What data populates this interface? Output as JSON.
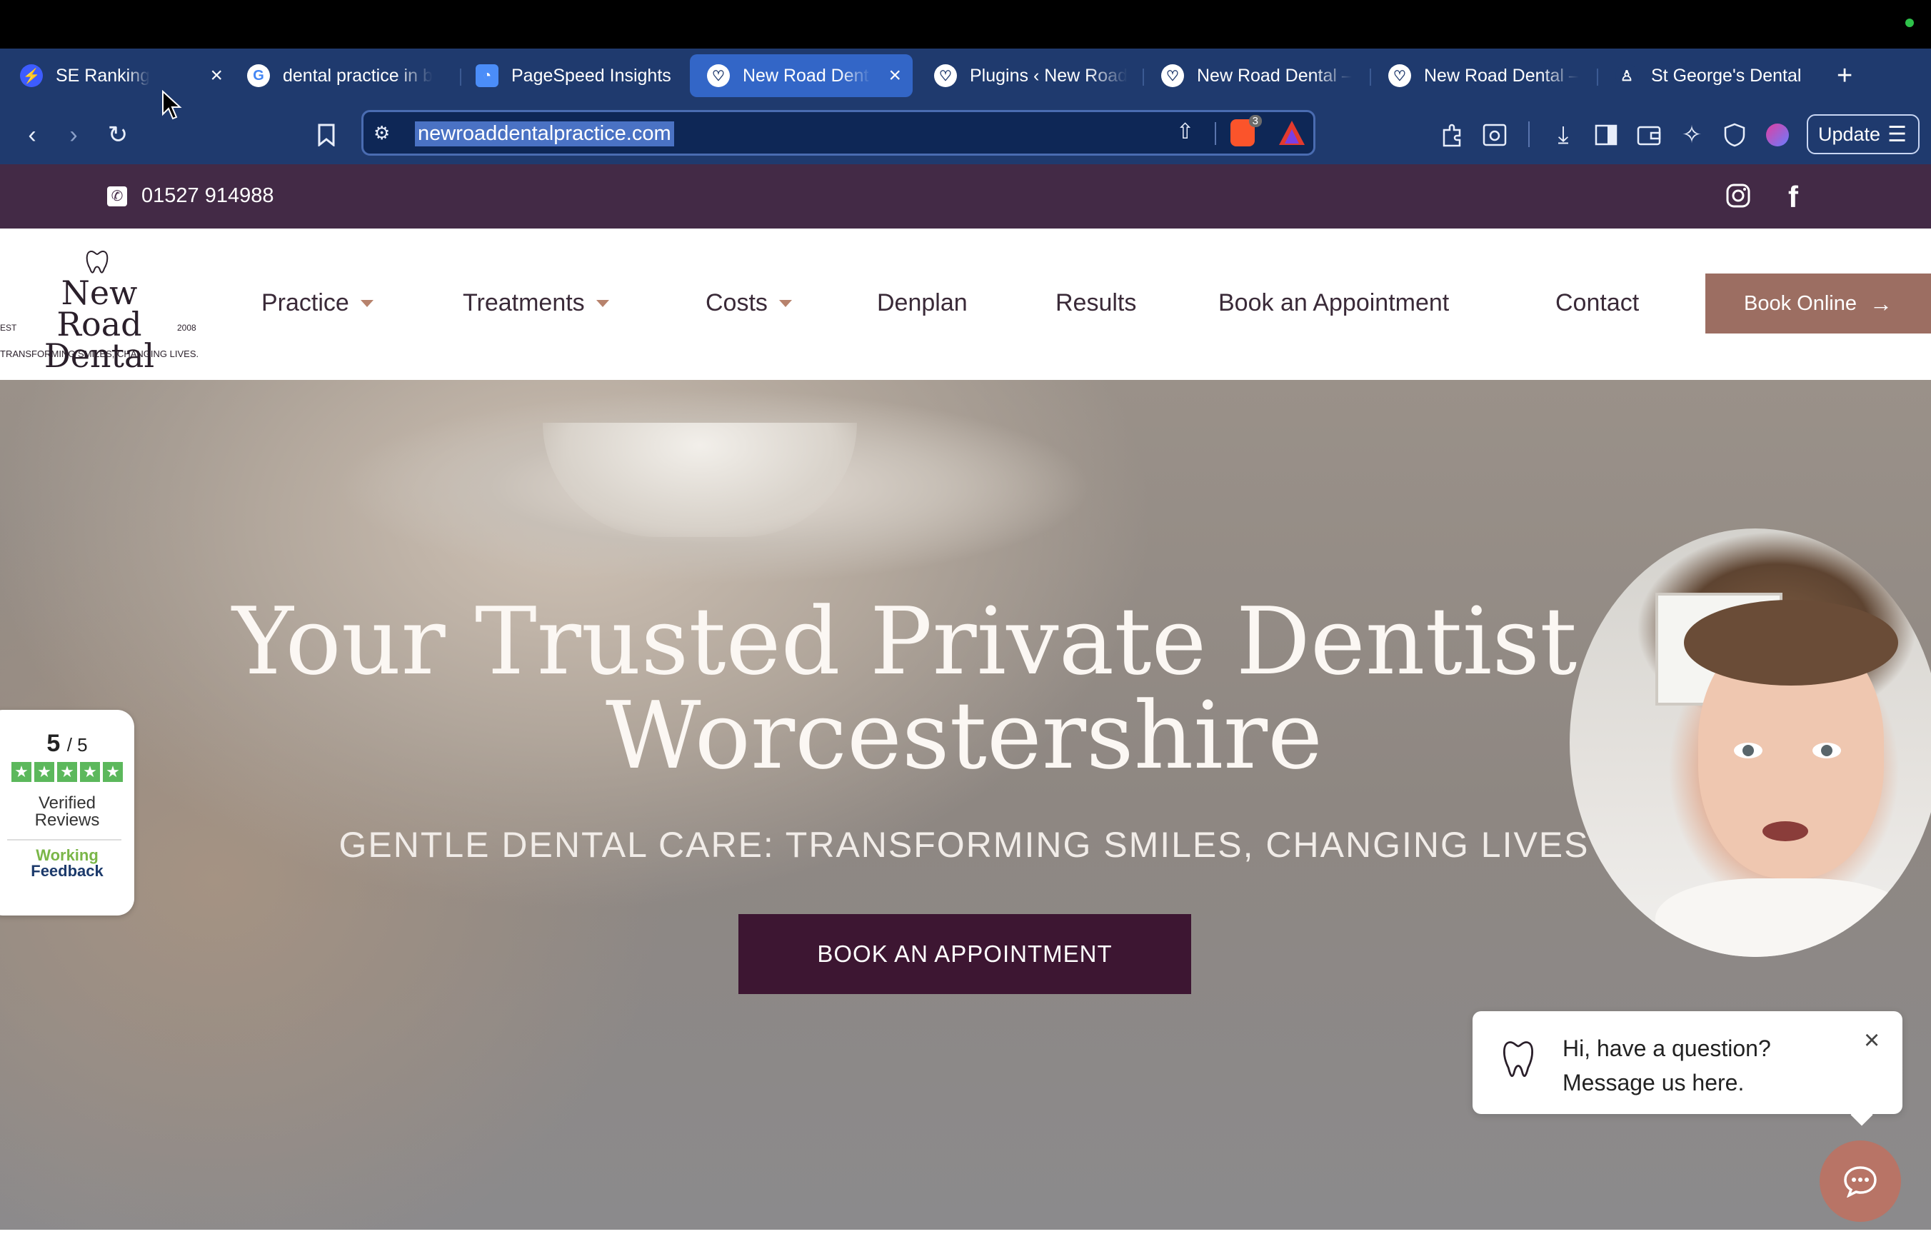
{
  "browser": {
    "tabs": [
      {
        "title": "SE Ranking",
        "active": false
      },
      {
        "title": "dental practice in b",
        "active": false
      },
      {
        "title": "PageSpeed Insights",
        "active": false
      },
      {
        "title": "New Road Dent",
        "active": true
      },
      {
        "title": "Plugins ‹ New Road",
        "active": false
      },
      {
        "title": "New Road Dental –",
        "active": false
      },
      {
        "title": "New Road Dental –",
        "active": false
      },
      {
        "title": "St George's Dental",
        "active": false
      }
    ],
    "url": "newroaddentalpractice.com",
    "shields_count": "3",
    "update_label": "Update"
  },
  "site": {
    "phone": "01527 914988",
    "logo": {
      "line1": "New Road",
      "line2": "Dental",
      "est": "EST",
      "year": "2008",
      "tagline": "TRANSFORMING SMILES, CHANGING LIVES."
    },
    "nav": [
      "Practice",
      "Treatments",
      "Costs",
      "Denplan",
      "Results",
      "Book an Appointment",
      "Contact"
    ],
    "book_online": "Book Online",
    "hero": {
      "title_line1": "Your Trusted Private Dentist in",
      "title_line2": "Worcestershire",
      "subtitle": "GENTLE DENTAL CARE: TRANSFORMING SMILES, CHANGING LIVES",
      "cta": "BOOK AN APPOINTMENT"
    },
    "reviews": {
      "score": "5",
      "out_of": "/ 5",
      "line1": "Verified",
      "line2": "Reviews",
      "brand1": "Working",
      "brand2": "Feedback"
    },
    "chat": {
      "line1": "Hi, have a question?",
      "line2": "Message us here."
    }
  },
  "colors": {
    "browser_chrome": "#1f3a6e",
    "site_topbar": "#432a46",
    "book_online": "#9c6e62",
    "hero_cta": "#3d1632",
    "chat_button": "#b87466"
  }
}
